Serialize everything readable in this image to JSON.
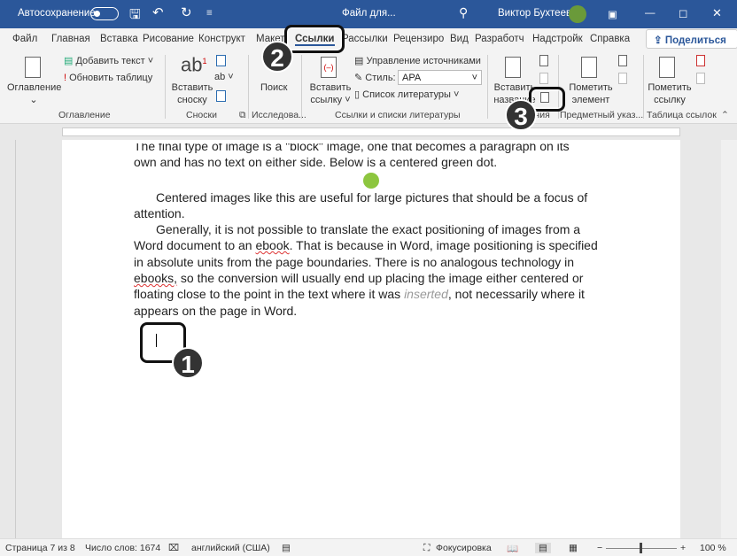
{
  "titlebar": {
    "autosave": "Автосохранение",
    "filename": "Файл для...",
    "user": "Виктор Бухтеев"
  },
  "tabs": [
    "Файл",
    "Главная",
    "Вставка",
    "Рисование",
    "Конструкт",
    "Макет",
    "Ссылки",
    "Рассылки",
    "Рецензиро",
    "Вид",
    "Разработч",
    "Надстройк",
    "Справка"
  ],
  "share": "Поделиться",
  "ribbon": {
    "toc": "Оглавление",
    "add_text": "Добавить текст",
    "update_table": "Обновить таблицу",
    "group_toc": "Оглавление",
    "insert_footnote_1": "Вставить",
    "insert_footnote_2": "сноску",
    "group_footnotes": "Сноски",
    "search": "Поиск",
    "group_research": "Исследова...",
    "insert_citation_1": "Вставить",
    "insert_citation_2": "ссылку",
    "manage_sources": "Управление источниками",
    "style_label": "Стиль:",
    "style_value": "APA",
    "bibliography": "Список литературы",
    "group_citations": "Ссылки и списки литературы",
    "insert_caption_1": "Вставить",
    "insert_caption_2": "название",
    "group_captions": "Названия",
    "mark_entry_1": "Пометить",
    "mark_entry_2": "элемент",
    "group_index": "Предметный указ...",
    "mark_citation_1": "Пометить",
    "mark_citation_2": "ссылку",
    "group_toa": "Таблица ссылок"
  },
  "document": {
    "lines": [
      "The final type of image is a \"block\" image, one that becomes a paragraph on its",
      "own and has no text on either side. Below is a centered green dot.",
      "Centered images like this are useful for large pictures that should be a focus of",
      "attention.",
      "Generally, it is not possible to translate the exact positioning of images from a"
    ],
    "l6a": "Word document to an ",
    "l6b": "ebook",
    "l6c": ". That is because in Word, image positioning is specified",
    "l7": "in absolute units from the page boundaries.  There is no analogous technology in",
    "l8a": "ebooks,",
    "l8b": " so the conversion will usually end up placing the image either centered or",
    "l9a": "floating close to the point in the text where it was ",
    "l9b": "inserted",
    "l9c": ", not necessarily where it",
    "l10": "appears on the page in Word."
  },
  "badges": [
    "1",
    "2",
    "3"
  ],
  "status": {
    "page": "Страница 7 из 8",
    "words": "Число слов: 1674",
    "language": "английский (США)",
    "focus": "Фокусировка",
    "zoom": "100 %",
    "zoom_percent": 100
  },
  "colors": {
    "title": "#2b579a",
    "dot": "#8dc63f"
  }
}
